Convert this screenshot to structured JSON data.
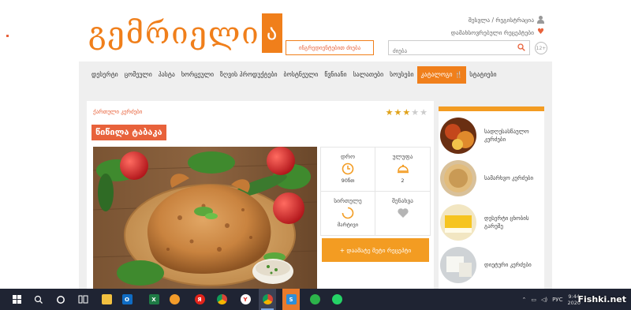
{
  "header": {
    "logo_text": "გემრიელი",
    "logo_box": "ა",
    "user_links": "შესვლა / რეგისტრაცია",
    "favorites_link": "დამახსოვრებული რეცეპტები",
    "ingredient_search_button": "ინგრედიენტებით ძიება",
    "search_placeholder": "ძიება",
    "age_badge": "12+"
  },
  "nav": {
    "items": [
      "დესერტი",
      "ცომეული",
      "პასტა",
      "ხორცეული",
      "ზღვის პროდუქტები",
      "ბოსტნეული",
      "წვნიანი",
      "სალათები",
      "სოუსები",
      "კატალოგი",
      "სტატიები"
    ],
    "active_index": 9
  },
  "recipe": {
    "breadcrumb": "ქართული კერძები",
    "rating": 3,
    "rating_max": 5,
    "title": "წიწილა ტაბაკა",
    "time_label": "დრო",
    "time_value": "90წთ",
    "servings_label": "ულუფა",
    "servings_value": "2",
    "difficulty_label": "სირთულე",
    "difficulty_value": "მარტივი",
    "save_label": "შენახვა",
    "more_button": "+ დაამატე მეტი რეცეპტი"
  },
  "sidebar": {
    "categories": [
      {
        "label": "სადღესასწაულო კერძები"
      },
      {
        "label": "სამარხვო კერძები"
      },
      {
        "label": "დესერტი ცხობის გარეშე"
      },
      {
        "label": "დიეტური კერძები"
      }
    ]
  },
  "taskbar": {
    "apps": [
      "file-explorer",
      "outlook",
      "excel",
      "lingualeo",
      "yandex",
      "chrome",
      "yandex-browser",
      "chrome",
      "skype",
      "wechat",
      "whatsapp"
    ],
    "language": "РУС",
    "time": "9:44",
    "date": "2020"
  },
  "watermark": "Fishki.net",
  "colors": {
    "accent": "#f07f1b",
    "title_bg": "#e8623b",
    "button": "#f39c22",
    "star_on": "#e0a21a",
    "taskbar": "#1f2433"
  }
}
